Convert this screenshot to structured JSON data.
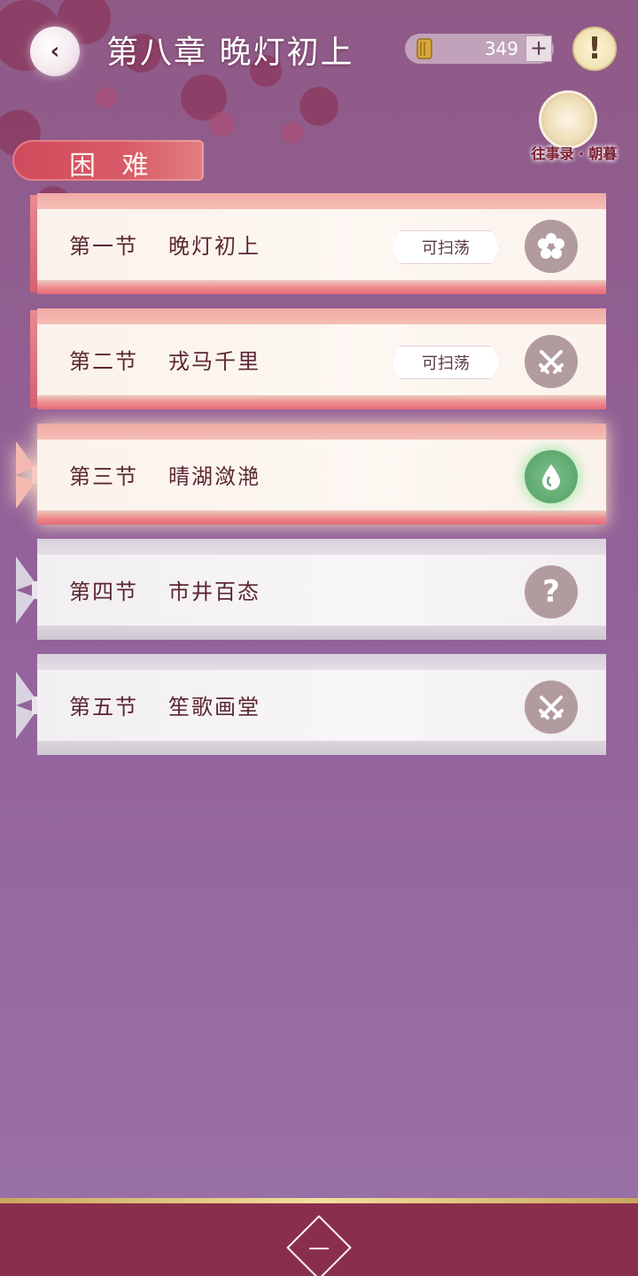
{
  "header": {
    "chapter_title": "第八章 晚灯初上",
    "currency_amount": "349",
    "memoir_label": "往事录 · 朝暮"
  },
  "difficulty_label": "困 难",
  "sections": [
    {
      "number": "第一节",
      "name": "晚灯初上",
      "sweep": "可扫荡",
      "icon": "flower-icon",
      "style": "pink"
    },
    {
      "number": "第二节",
      "name": "戎马千里",
      "sweep": "可扫荡",
      "icon": "crossed-swords-icon",
      "style": "pink"
    },
    {
      "number": "第三节",
      "name": "晴湖潋滟",
      "sweep": "",
      "icon": "water-drop-icon",
      "style": "pink-active"
    },
    {
      "number": "第四节",
      "name": "市井百态",
      "sweep": "",
      "icon": "question-icon",
      "style": "grey"
    },
    {
      "number": "第五节",
      "name": "笙歌画堂",
      "sweep": "",
      "icon": "crossed-swords-icon",
      "style": "grey"
    }
  ],
  "footer": {
    "page_label": "一"
  },
  "colors": {
    "accent_pink": "#d95b68",
    "bottom_bar": "#8a2f4b",
    "active_green": "#5ea96f"
  }
}
